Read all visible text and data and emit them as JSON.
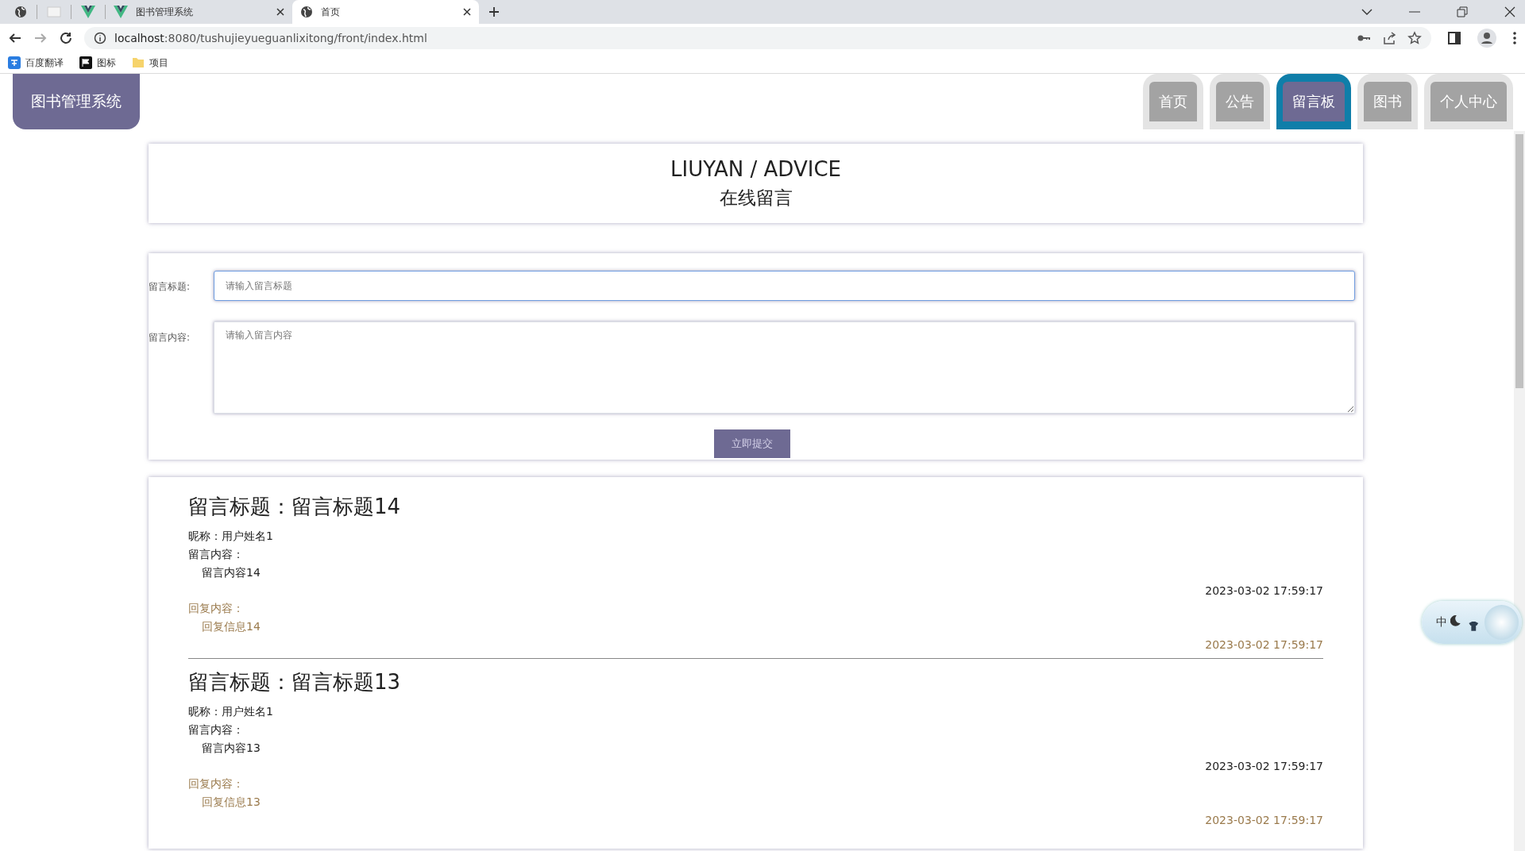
{
  "browser": {
    "tabs": [
      {
        "selected": false
      },
      {
        "selected": false
      },
      {
        "selected": false
      },
      {
        "title": "图书管理系统",
        "selected": false
      },
      {
        "title": "首页",
        "selected": true
      }
    ],
    "url_host": "localhost",
    "url_rest": ":8080/tushujieyueguanlixitong/front/index.html",
    "bookmarks": [
      {
        "label": "百度翻译"
      },
      {
        "label": "图标"
      },
      {
        "label": "项目"
      }
    ]
  },
  "site": {
    "logo": "图书管理系统",
    "nav": [
      {
        "label": "首页",
        "selected": false
      },
      {
        "label": "公告",
        "selected": false
      },
      {
        "label": "留言板",
        "selected": true
      },
      {
        "label": "图书",
        "selected": false
      },
      {
        "label": "个人中心",
        "selected": false
      }
    ]
  },
  "header": {
    "title": "LIUYAN / ADVICE",
    "subtitle": "在线留言"
  },
  "form": {
    "title_label": "留言标题:",
    "title_placeholder": "请输入留言标题",
    "content_label": "留言内容:",
    "content_placeholder": "请输入留言内容",
    "submit": "立即提交"
  },
  "messages": [
    {
      "title": "留言标题：留言标题14",
      "nickname": "昵称：用户姓名1",
      "content_label": "留言内容：",
      "content": "留言内容14",
      "time": "2023-03-02 17:59:17",
      "reply_label": "回复内容：",
      "reply": "回复信息14",
      "reply_time": "2023-03-02 17:59:17"
    },
    {
      "title": "留言标题：留言标题13",
      "nickname": "昵称：用户姓名1",
      "content_label": "留言内容：",
      "content": "留言内容13",
      "time": "2023-03-02 17:59:17",
      "reply_label": "回复内容：",
      "reply": "回复信息13",
      "reply_time": "2023-03-02 17:59:17"
    }
  ],
  "ime_widget": {
    "mode": "中"
  }
}
